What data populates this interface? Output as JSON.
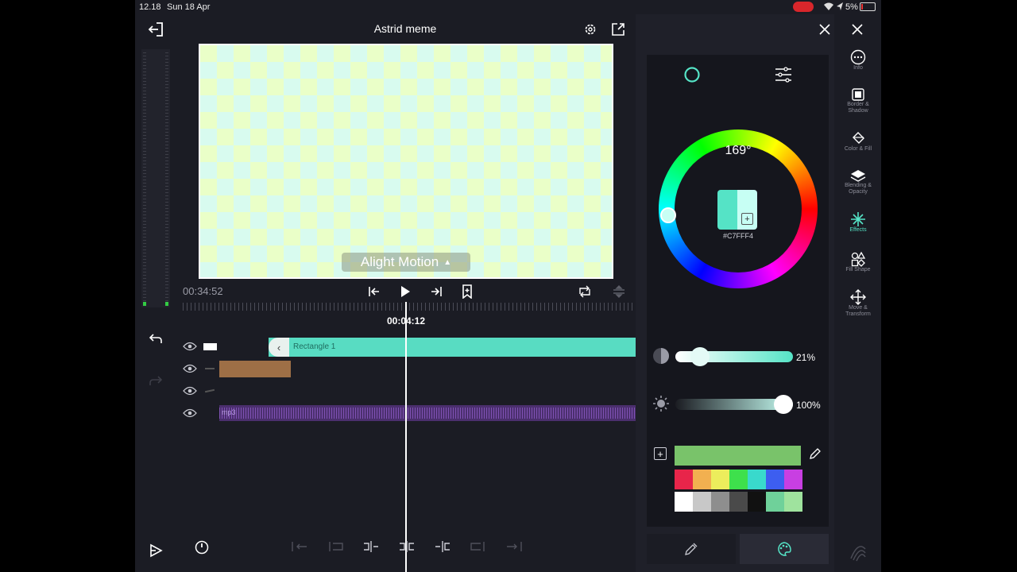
{
  "status": {
    "time": "12.18",
    "date": "Sun 18 Apr",
    "battery": "5%"
  },
  "project": {
    "title": "Astrid meme"
  },
  "preview": {
    "watermark": "Alight Motion"
  },
  "transport": {
    "current_time": "00:34:52",
    "playhead_time": "00:04:12"
  },
  "timeline": {
    "layers": [
      {
        "label": "Rectangle 1",
        "type": "shape"
      },
      {
        "label": "",
        "type": "image"
      },
      {
        "label": "",
        "type": "shape"
      },
      {
        "label": "mp3",
        "type": "audio"
      }
    ]
  },
  "color_panel": {
    "hue": "169°",
    "hex": "#C7FFF4",
    "saturation": "21%",
    "brightness": "100%",
    "saturation_value": 0.21,
    "brightness_value": 1.0,
    "accent": "#55e3c6"
  },
  "swatches": {
    "current": "#79c36a",
    "row1": [
      "#e8254a",
      "#f2b050",
      "#eced5c",
      "#3ee04c",
      "#39d9cc",
      "#3d5ef0",
      "#c83fe2"
    ],
    "row2": [
      "#ffffff",
      "#c8c8c8",
      "#8e8e8e",
      "#4a4a4a",
      "#111111",
      "#6fd19a",
      "#9fe39e"
    ]
  },
  "side_menu": {
    "items": [
      {
        "label": "Info",
        "icon": "more-icon"
      },
      {
        "label": "Border & Shadow",
        "icon": "border-icon"
      },
      {
        "label": "Color & Fill",
        "icon": "paint-bucket-icon"
      },
      {
        "label": "Blending & Opacity",
        "icon": "layers-icon"
      },
      {
        "label": "Effects",
        "icon": "sparkle-icon"
      },
      {
        "label": "Fill Shape",
        "icon": "shapes-icon"
      },
      {
        "label": "Move & Transform",
        "icon": "move-icon"
      }
    ]
  }
}
